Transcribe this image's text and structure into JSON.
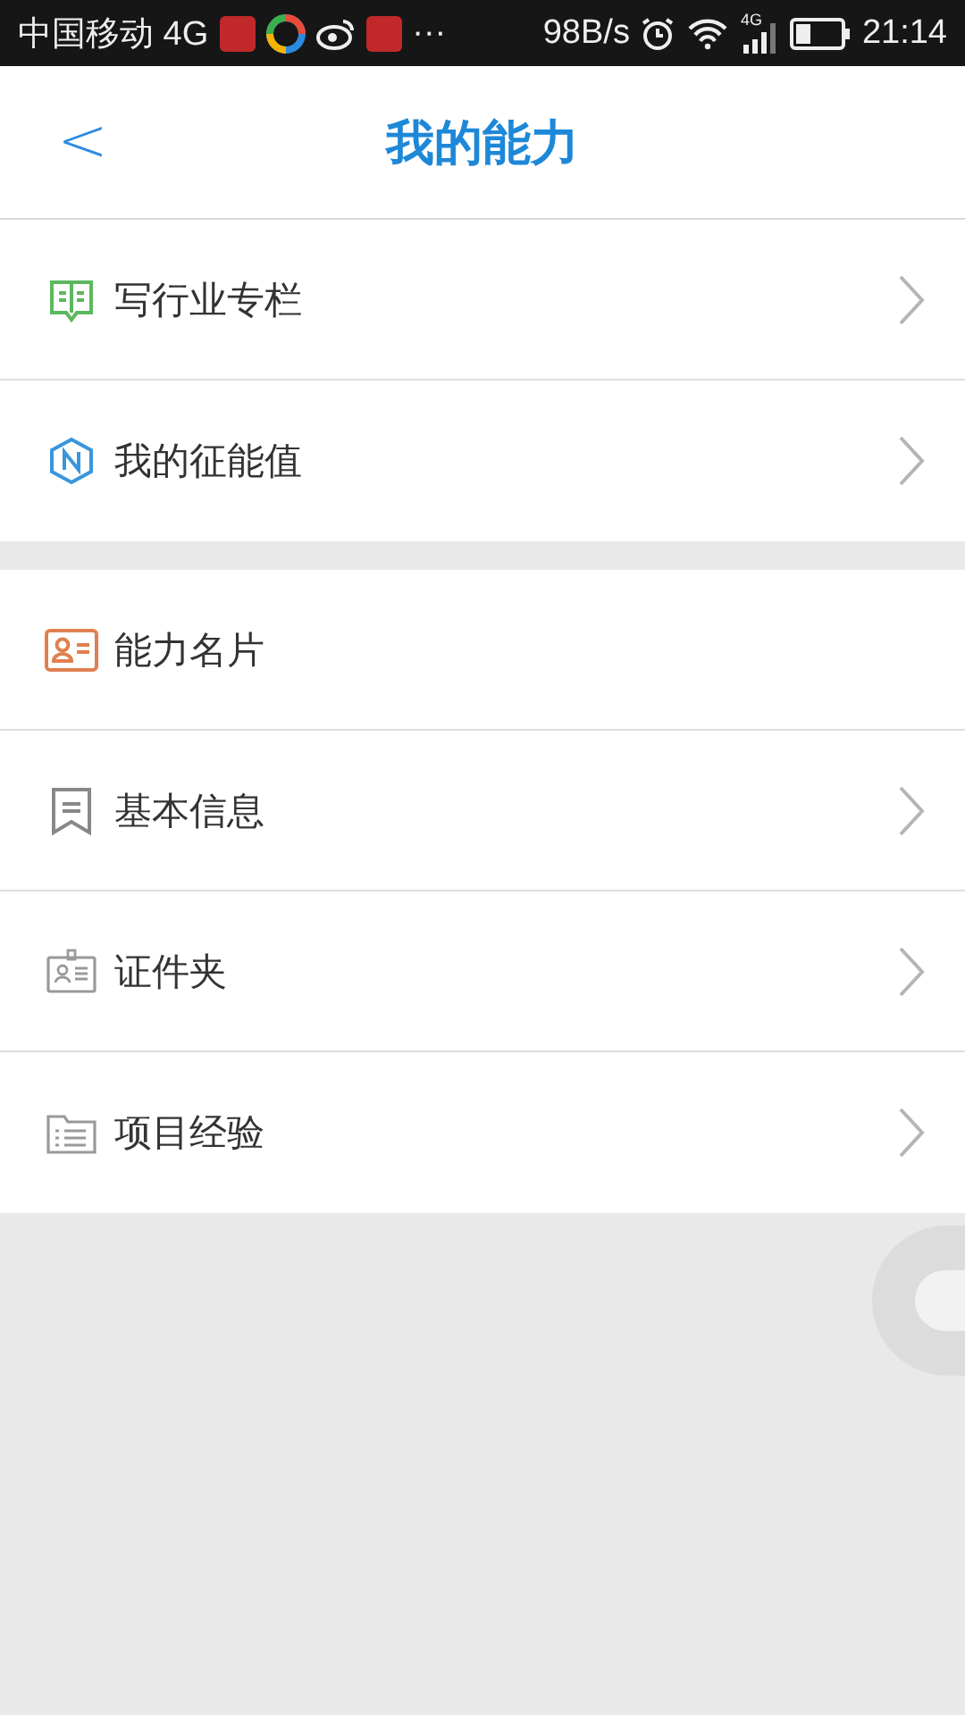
{
  "status_bar": {
    "carrier": "中国移动 4G",
    "more": "···",
    "speed": "98B/s",
    "network": "4G",
    "time": "21:14"
  },
  "header": {
    "back": "<",
    "title": "我的能力"
  },
  "groups": [
    {
      "items": [
        {
          "kind": "book",
          "label": "写行业专栏",
          "arrow": true
        },
        {
          "kind": "hexagon",
          "label": "我的征能值",
          "arrow": true
        }
      ]
    },
    {
      "items": [
        {
          "kind": "card",
          "label": "能力名片",
          "arrow": false
        },
        {
          "kind": "bookmark",
          "label": "基本信息",
          "arrow": true
        },
        {
          "kind": "badge",
          "label": "证件夹",
          "arrow": true
        },
        {
          "kind": "folder",
          "label": "项目经验",
          "arrow": true
        }
      ]
    }
  ]
}
